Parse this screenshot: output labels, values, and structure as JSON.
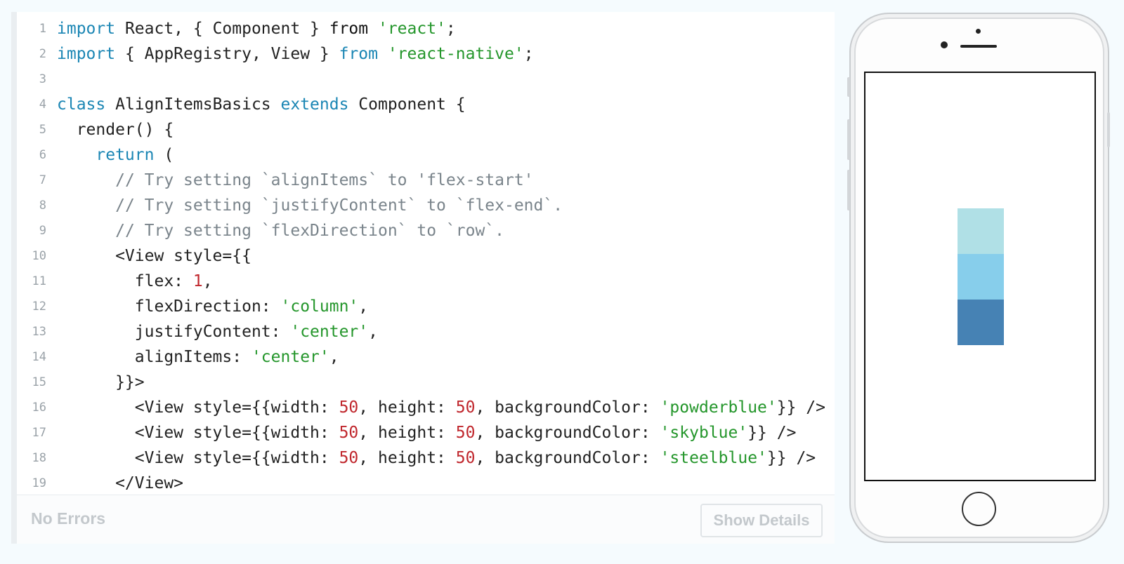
{
  "editor": {
    "lines": [
      {
        "n": "1",
        "tokens": [
          {
            "t": "import",
            "c": "kw"
          },
          {
            "t": " React, { Component } ",
            "c": ""
          },
          {
            "t": "from",
            "c": "kd"
          },
          {
            "t": " ",
            "c": ""
          },
          {
            "t": "'react'",
            "c": "str"
          },
          {
            "t": ";",
            "c": ""
          }
        ]
      },
      {
        "n": "2",
        "tokens": [
          {
            "t": "import",
            "c": "kw"
          },
          {
            "t": " { AppRegistry, View } ",
            "c": ""
          },
          {
            "t": "from",
            "c": "kw"
          },
          {
            "t": " ",
            "c": ""
          },
          {
            "t": "'react-native'",
            "c": "str"
          },
          {
            "t": ";",
            "c": ""
          }
        ]
      },
      {
        "n": "3",
        "tokens": []
      },
      {
        "n": "4",
        "tokens": [
          {
            "t": "class",
            "c": "kw"
          },
          {
            "t": " AlignItemsBasics ",
            "c": ""
          },
          {
            "t": "extends",
            "c": "kw"
          },
          {
            "t": " Component {",
            "c": ""
          }
        ]
      },
      {
        "n": "5",
        "tokens": [
          {
            "t": "  render() {",
            "c": ""
          }
        ]
      },
      {
        "n": "6",
        "tokens": [
          {
            "t": "    ",
            "c": ""
          },
          {
            "t": "return",
            "c": "kw"
          },
          {
            "t": " (",
            "c": ""
          }
        ]
      },
      {
        "n": "7",
        "tokens": [
          {
            "t": "      ",
            "c": ""
          },
          {
            "t": "// Try setting `alignItems` to 'flex-start'",
            "c": "cm"
          }
        ]
      },
      {
        "n": "8",
        "tokens": [
          {
            "t": "      ",
            "c": ""
          },
          {
            "t": "// Try setting `justifyContent` to `flex-end`.",
            "c": "cm"
          }
        ]
      },
      {
        "n": "9",
        "tokens": [
          {
            "t": "      ",
            "c": ""
          },
          {
            "t": "// Try setting `flexDirection` to `row`.",
            "c": "cm"
          }
        ]
      },
      {
        "n": "10",
        "tokens": [
          {
            "t": "      <View style={{",
            "c": ""
          }
        ]
      },
      {
        "n": "11",
        "tokens": [
          {
            "t": "        flex: ",
            "c": ""
          },
          {
            "t": "1",
            "c": "num"
          },
          {
            "t": ",",
            "c": ""
          }
        ]
      },
      {
        "n": "12",
        "tokens": [
          {
            "t": "        flexDirection: ",
            "c": ""
          },
          {
            "t": "'column'",
            "c": "str"
          },
          {
            "t": ",",
            "c": ""
          }
        ]
      },
      {
        "n": "13",
        "tokens": [
          {
            "t": "        justifyContent: ",
            "c": ""
          },
          {
            "t": "'center'",
            "c": "str"
          },
          {
            "t": ",",
            "c": ""
          }
        ]
      },
      {
        "n": "14",
        "tokens": [
          {
            "t": "        alignItems: ",
            "c": ""
          },
          {
            "t": "'center'",
            "c": "str"
          },
          {
            "t": ",",
            "c": ""
          }
        ]
      },
      {
        "n": "15",
        "tokens": [
          {
            "t": "      }}>",
            "c": ""
          }
        ]
      },
      {
        "n": "16",
        "tokens": [
          {
            "t": "        <View style={{width: ",
            "c": ""
          },
          {
            "t": "50",
            "c": "num"
          },
          {
            "t": ", height: ",
            "c": ""
          },
          {
            "t": "50",
            "c": "num"
          },
          {
            "t": ", backgroundColor: ",
            "c": ""
          },
          {
            "t": "'powderblue'",
            "c": "str"
          },
          {
            "t": "}} />",
            "c": ""
          }
        ]
      },
      {
        "n": "17",
        "tokens": [
          {
            "t": "        <View style={{width: ",
            "c": ""
          },
          {
            "t": "50",
            "c": "num"
          },
          {
            "t": ", height: ",
            "c": ""
          },
          {
            "t": "50",
            "c": "num"
          },
          {
            "t": ", backgroundColor: ",
            "c": ""
          },
          {
            "t": "'skyblue'",
            "c": "str"
          },
          {
            "t": "}} />",
            "c": ""
          }
        ]
      },
      {
        "n": "18",
        "tokens": [
          {
            "t": "        <View style={{width: ",
            "c": ""
          },
          {
            "t": "50",
            "c": "num"
          },
          {
            "t": ", height: ",
            "c": ""
          },
          {
            "t": "50",
            "c": "num"
          },
          {
            "t": ", backgroundColor: ",
            "c": ""
          },
          {
            "t": "'steelblue'",
            "c": "str"
          },
          {
            "t": "}} />",
            "c": ""
          }
        ]
      },
      {
        "n": "19",
        "tokens": [
          {
            "t": "      </View>",
            "c": ""
          }
        ]
      }
    ]
  },
  "status": {
    "text": "No Errors",
    "button_label": "Show Details"
  },
  "preview": {
    "boxes": [
      {
        "name": "powderblue",
        "color": "#b0e0e6"
      },
      {
        "name": "skyblue",
        "color": "#87ceeb"
      },
      {
        "name": "steelblue",
        "color": "#4682b4"
      }
    ]
  }
}
